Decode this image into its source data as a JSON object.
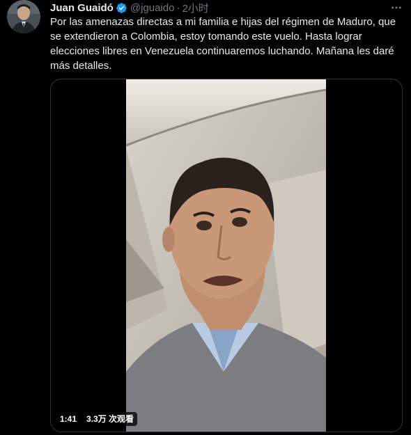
{
  "tweet": {
    "author_name": "Juan Guaidó",
    "handle": "@jguaido",
    "separator": "·",
    "time": "2小时",
    "text": "Por las amenazas directas a mi familia e hijas del régimen de Maduro, que se extendieron a Colombia, estoy tomando este vuelo. Hasta lograr elecciones libres en Venezuela continuaremos luchando. Mañana les daré más detalles.",
    "verified_icon": "verified-badge-icon",
    "more_icon": "more-options-icon"
  },
  "media": {
    "duration": "1:41",
    "views": "3.3万 次观看"
  },
  "colors": {
    "background": "#000000",
    "text": "#e7e9ea",
    "muted": "#71767b",
    "verified": "#1d9bf0",
    "border": "#2f3336"
  }
}
